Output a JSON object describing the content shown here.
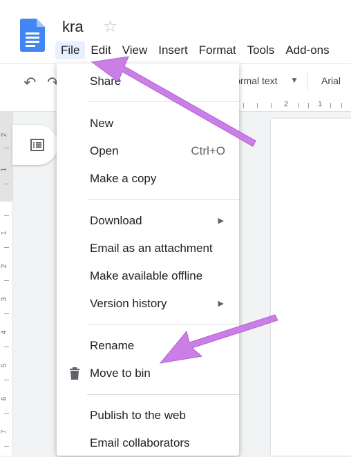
{
  "document": {
    "title": "kra"
  },
  "menubar": [
    "File",
    "Edit",
    "View",
    "Insert",
    "Format",
    "Tools",
    "Add-ons"
  ],
  "toolbar": {
    "paragraph_style": "Normal text",
    "font": "Arial"
  },
  "ruler": {
    "h_numbers": [
      "2",
      "1"
    ],
    "v_numbers": [
      "2",
      "1",
      "1",
      "2",
      "3",
      "4",
      "5",
      "6",
      "7"
    ]
  },
  "file_menu": {
    "share": "Share",
    "new": "New",
    "open": "Open",
    "open_shortcut": "Ctrl+O",
    "make_copy": "Make a copy",
    "download": "Download",
    "email_attachment": "Email as an attachment",
    "offline": "Make available offline",
    "version_history": "Version history",
    "rename": "Rename",
    "move_to_bin": "Move to bin",
    "publish": "Publish to the web",
    "email_collaborators": "Email collaborators"
  },
  "colors": {
    "doc_blue": "#4285f4",
    "arrow": "#c97fe6",
    "menu_active": "#e8f0fe"
  },
  "icons": [
    "docs-logo-icon",
    "star-icon",
    "undo-icon",
    "redo-icon",
    "caret-down-icon",
    "outline-icon",
    "submenu-arrow-icon",
    "trash-icon"
  ]
}
